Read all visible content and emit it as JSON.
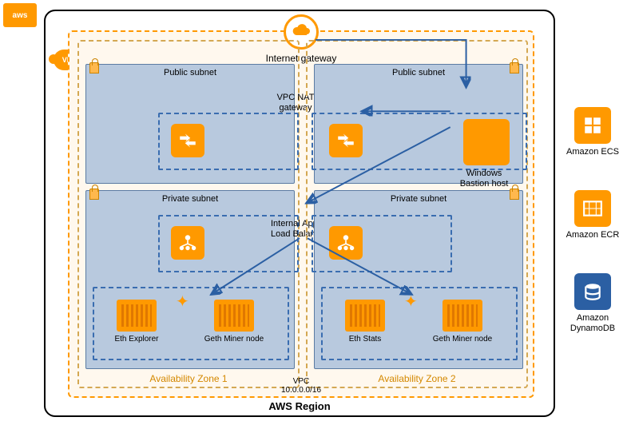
{
  "diagram": {
    "region_label": "AWS Region",
    "vpc_badge": "VPC",
    "vpc_cidr_label": "VPC\n10.0.0.0/16",
    "internet_gateway": "Internet gateway",
    "nat_gateway_label": "VPC NAT gateway",
    "load_balancer_label": "Internal Application Load Balancers",
    "availability_zones": [
      {
        "label": "Availability Zone 1",
        "public_subnet": {
          "label": "Public subnet"
        },
        "private_subnet": {
          "label": "Private subnet",
          "nodes": [
            {
              "label": "Eth Explorer"
            },
            {
              "label": "Geth Miner node"
            }
          ]
        }
      },
      {
        "label": "Availability Zone 2",
        "public_subnet": {
          "label": "Public subnet",
          "bastion_label": "Windows Bastion host"
        },
        "private_subnet": {
          "label": "Private subnet",
          "nodes": [
            {
              "label": "Eth Stats"
            },
            {
              "label": "Geth Miner node"
            }
          ]
        }
      }
    ]
  },
  "services": [
    {
      "name": "Amazon ECS"
    },
    {
      "name": "Amazon ECR"
    },
    {
      "name": "Amazon DynamoDB"
    }
  ],
  "icons": {
    "aws": "aws",
    "cloud": "cloud",
    "nat": "nat",
    "elb": "elb",
    "ecs": "ecs",
    "ecr": "ecr",
    "ddb": "ddb"
  }
}
